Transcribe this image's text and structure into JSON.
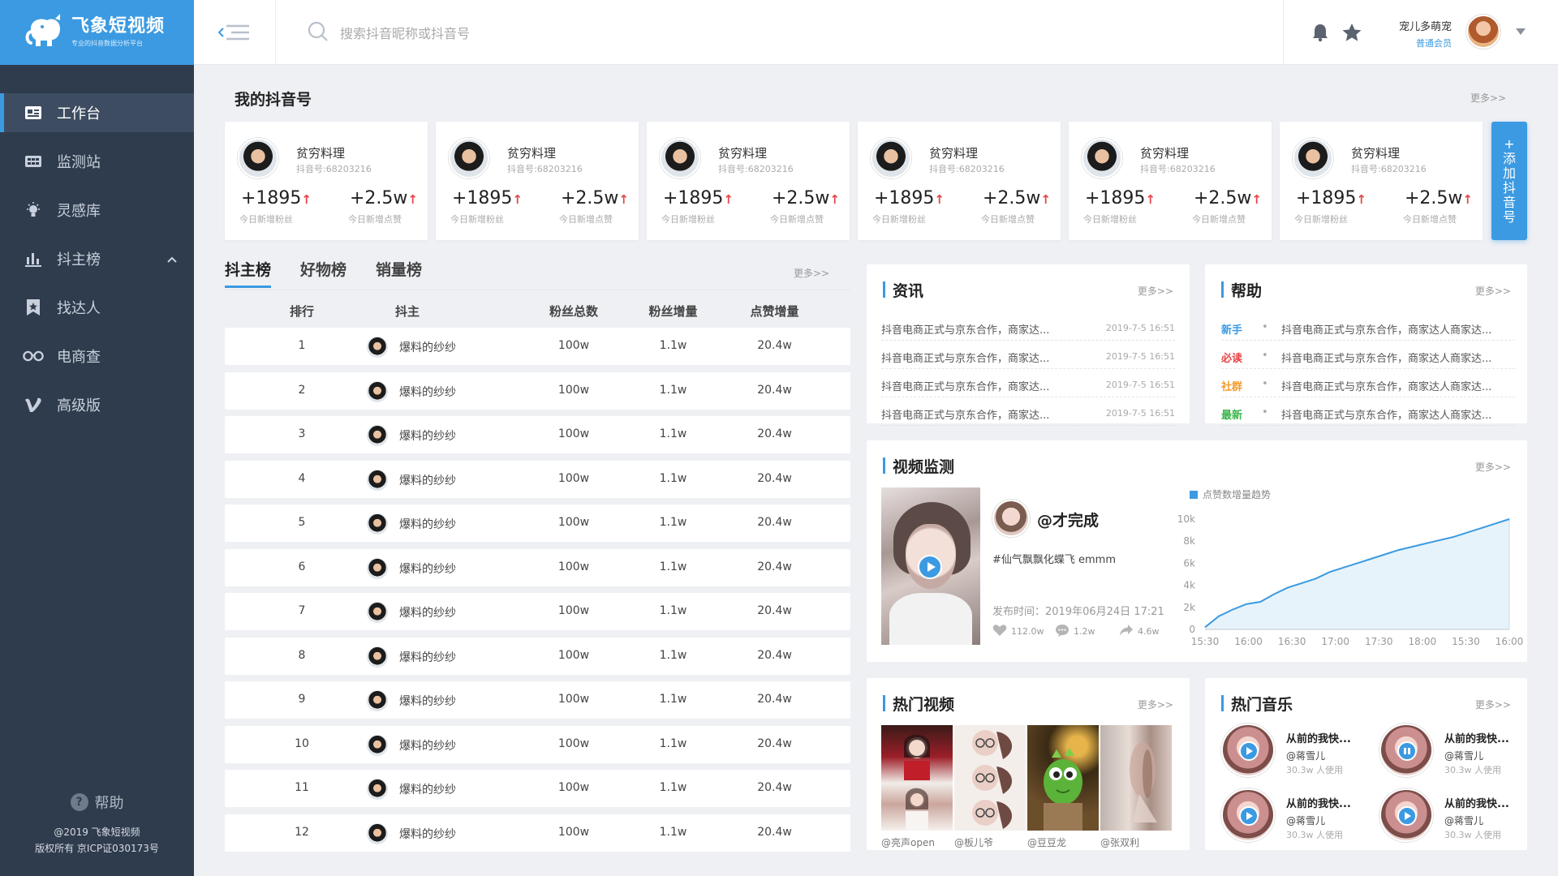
{
  "brand": {
    "name": "飞象短视频",
    "tagline": "专业的抖音数据分析平台"
  },
  "sidebar": {
    "items": [
      {
        "label": "工作台",
        "icon": "workbench-icon",
        "active": true
      },
      {
        "label": "监测站",
        "icon": "monitor-icon"
      },
      {
        "label": "灵感库",
        "icon": "bulb-icon"
      },
      {
        "label": "抖主榜",
        "icon": "bar-chart-icon",
        "expanded": true
      },
      {
        "label": "找达人",
        "icon": "bookmark-star-icon"
      },
      {
        "label": "电商查",
        "icon": "glasses-icon"
      },
      {
        "label": "高级版",
        "icon": "v-icon"
      }
    ],
    "help_label": "帮助",
    "copyright_line1": "@2019 飞象短视频",
    "copyright_line2": "版权所有 京ICP证030173号"
  },
  "header": {
    "search_placeholder": "搜索抖音昵称或抖音号",
    "user_name": "宠儿多萌宠",
    "user_role": "普通会员"
  },
  "accounts": {
    "title": "我的抖音号",
    "more": "更多>>",
    "add_label": "+ 添 加 抖 音 号",
    "add_chars": [
      "+",
      "添",
      "加",
      "抖",
      "音",
      "号"
    ],
    "items": [
      {
        "name": "贫穷料理",
        "id": "抖音号:68203216",
        "fans": "+1895",
        "fans_label": "今日新增粉丝",
        "likes": "+2.5w",
        "likes_label": "今日新增点赞"
      },
      {
        "name": "贫穷料理",
        "id": "抖音号:68203216",
        "fans": "+1895",
        "fans_label": "今日新增粉丝",
        "likes": "+2.5w",
        "likes_label": "今日新增点赞"
      },
      {
        "name": "贫穷料理",
        "id": "抖音号:68203216",
        "fans": "+1895",
        "fans_label": "今日新增粉丝",
        "likes": "+2.5w",
        "likes_label": "今日新增点赞"
      },
      {
        "name": "贫穷料理",
        "id": "抖音号:68203216",
        "fans": "+1895",
        "fans_label": "今日新增粉丝",
        "likes": "+2.5w",
        "likes_label": "今日新增点赞"
      },
      {
        "name": "贫穷料理",
        "id": "抖音号:68203216",
        "fans": "+1895",
        "fans_label": "今日新增粉丝",
        "likes": "+2.5w",
        "likes_label": "今日新增点赞"
      },
      {
        "name": "贫穷料理",
        "id": "抖音号:68203216",
        "fans": "+1895",
        "fans_label": "今日新增粉丝",
        "likes": "+2.5w",
        "likes_label": "今日新增点赞"
      }
    ]
  },
  "ranking": {
    "tabs": [
      "抖主榜",
      "好物榜",
      "销量榜"
    ],
    "more": "更多>>",
    "columns": [
      "排行",
      "抖主",
      "粉丝总数",
      "粉丝增量",
      "点赞增量"
    ],
    "rows": [
      {
        "rank": "1",
        "name": "爆料的纱纱",
        "total": "100w",
        "fans_inc": "1.1w",
        "likes_inc": "20.4w"
      },
      {
        "rank": "2",
        "name": "爆料的纱纱",
        "total": "100w",
        "fans_inc": "1.1w",
        "likes_inc": "20.4w"
      },
      {
        "rank": "3",
        "name": "爆料的纱纱",
        "total": "100w",
        "fans_inc": "1.1w",
        "likes_inc": "20.4w"
      },
      {
        "rank": "4",
        "name": "爆料的纱纱",
        "total": "100w",
        "fans_inc": "1.1w",
        "likes_inc": "20.4w"
      },
      {
        "rank": "5",
        "name": "爆料的纱纱",
        "total": "100w",
        "fans_inc": "1.1w",
        "likes_inc": "20.4w"
      },
      {
        "rank": "6",
        "name": "爆料的纱纱",
        "total": "100w",
        "fans_inc": "1.1w",
        "likes_inc": "20.4w"
      },
      {
        "rank": "7",
        "name": "爆料的纱纱",
        "total": "100w",
        "fans_inc": "1.1w",
        "likes_inc": "20.4w"
      },
      {
        "rank": "8",
        "name": "爆料的纱纱",
        "total": "100w",
        "fans_inc": "1.1w",
        "likes_inc": "20.4w"
      },
      {
        "rank": "9",
        "name": "爆料的纱纱",
        "total": "100w",
        "fans_inc": "1.1w",
        "likes_inc": "20.4w"
      },
      {
        "rank": "10",
        "name": "爆料的纱纱",
        "total": "100w",
        "fans_inc": "1.1w",
        "likes_inc": "20.4w"
      },
      {
        "rank": "11",
        "name": "爆料的纱纱",
        "total": "100w",
        "fans_inc": "1.1w",
        "likes_inc": "20.4w"
      },
      {
        "rank": "12",
        "name": "爆料的纱纱",
        "total": "100w",
        "fans_inc": "1.1w",
        "likes_inc": "20.4w"
      }
    ]
  },
  "news": {
    "title": "资讯",
    "more": "更多>>",
    "items": [
      {
        "text": "抖音电商正式与京东合作，商家达...",
        "date": "2019-7-5 16:51"
      },
      {
        "text": "抖音电商正式与京东合作，商家达...",
        "date": "2019-7-5 16:51"
      },
      {
        "text": "抖音电商正式与京东合作，商家达...",
        "date": "2019-7-5 16:51"
      },
      {
        "text": "抖音电商正式与京东合作，商家达...",
        "date": "2019-7-5 16:51"
      }
    ]
  },
  "help_panel": {
    "title": "帮助",
    "more": "更多>>",
    "items": [
      {
        "tag": "新手",
        "color": "#3b9ae1",
        "text": "抖音电商正式与京东合作，商家达人商家达..."
      },
      {
        "tag": "必读",
        "color": "#e64545",
        "text": "抖音电商正式与京东合作，商家达人商家达..."
      },
      {
        "tag": "社群",
        "color": "#f39c2f",
        "text": "抖音电商正式与京东合作，商家达人商家达..."
      },
      {
        "tag": "最新",
        "color": "#3bb54a",
        "text": "抖音电商正式与京东合作，商家达人商家达..."
      }
    ]
  },
  "video_monitor": {
    "title": "视频监测",
    "more": "更多>>",
    "user": "@才完成",
    "desc": "#仙气飘飘化蝶飞 emmm",
    "publish_time": "发布时间：2019年06月24日 17:21",
    "likes": "112.0w",
    "comments": "1.2w",
    "shares": "4.6w"
  },
  "chart_data": {
    "type": "area",
    "legend": "点赞数增量趋势",
    "legend_placement": "top-left",
    "categories": [
      "15:30",
      "16:00",
      "16:30",
      "17:00",
      "17:30",
      "18:00",
      "15:30",
      "16:00"
    ],
    "x_ticks": [
      "15:30",
      "16:00",
      "16:30",
      "17:00",
      "17:30",
      "18:00",
      "15:30",
      "16:00"
    ],
    "y_ticks": [
      "0",
      "2k",
      "4k",
      "6k",
      "8k",
      "10k"
    ],
    "ylim": [
      0,
      10000
    ],
    "values": [
      200,
      1200,
      1800,
      2300,
      2500,
      3200,
      3800,
      4200,
      4600,
      5200,
      5600,
      6000,
      6400,
      6800,
      7200,
      7500,
      7800,
      8100,
      8400,
      8800,
      9200,
      9600,
      10000
    ],
    "color": "#3b9ae1",
    "grid": false
  },
  "hot_videos": {
    "title": "热门视频",
    "more": "更多>>",
    "items": [
      {
        "author": "@亮声open"
      },
      {
        "author": "@板儿爷"
      },
      {
        "author": "@豆豆龙"
      },
      {
        "author": "@张双利"
      }
    ]
  },
  "hot_music": {
    "title": "热门音乐",
    "more": "更多>>",
    "items": [
      {
        "title": "从前的我快...",
        "artist": "@蒋雪儿",
        "usage": "30.3w 人使用",
        "state": "play"
      },
      {
        "title": "从前的我快...",
        "artist": "@蒋雪儿",
        "usage": "30.3w 人使用",
        "state": "pause"
      },
      {
        "title": "从前的我快...",
        "artist": "@蒋雪儿",
        "usage": "30.3w 人使用",
        "state": "play"
      },
      {
        "title": "从前的我快...",
        "artist": "@蒋雪儿",
        "usage": "30.3w 人使用",
        "state": "play"
      }
    ]
  }
}
